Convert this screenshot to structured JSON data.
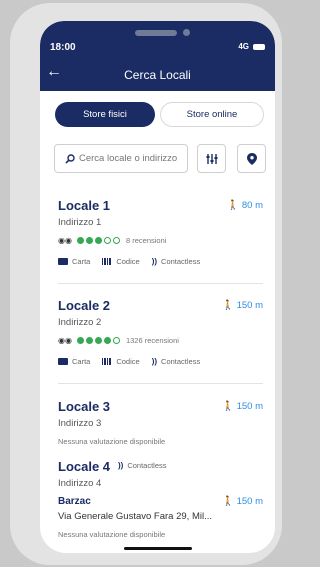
{
  "status": {
    "time": "18:00",
    "network": "4G"
  },
  "header": {
    "title": "Cerca Locali"
  },
  "tabs": [
    {
      "label": "Store fisici",
      "active": true
    },
    {
      "label": "Store online",
      "active": false
    }
  ],
  "search": {
    "placeholder": "Cerca locale o indirizzo"
  },
  "stores": [
    {
      "name": "Locale 1",
      "address": "Indirizzo 1",
      "distance": "80 m",
      "rating": 3,
      "rating_max": 5,
      "reviews": "8 recensioni",
      "payments": [
        "Carta",
        "Codice",
        "Contactless"
      ]
    },
    {
      "name": "Locale 2",
      "address": "Indirizzo 2",
      "distance": "150 m",
      "rating": 4,
      "rating_max": 5,
      "reviews": "1326 recensioni",
      "payments": [
        "Carta",
        "Codice",
        "Contactless"
      ]
    },
    {
      "name": "Locale 3",
      "address": "Indirizzo 3",
      "distance": "150 m",
      "no_rating": "Nessuna valutazione disponibile"
    },
    {
      "name": "Locale 4",
      "address": "Indirizzo 4",
      "payment": "Contactless"
    },
    {
      "name": "Barzac",
      "address": "Via Generale Gustavo Fara 29, Mil...",
      "distance": "150 m",
      "no_rating": "Nessuna valutazione disponibile"
    }
  ],
  "colors": {
    "primary": "#1a2c63",
    "distance": "#2b8fe4",
    "rating": "#34a853"
  }
}
